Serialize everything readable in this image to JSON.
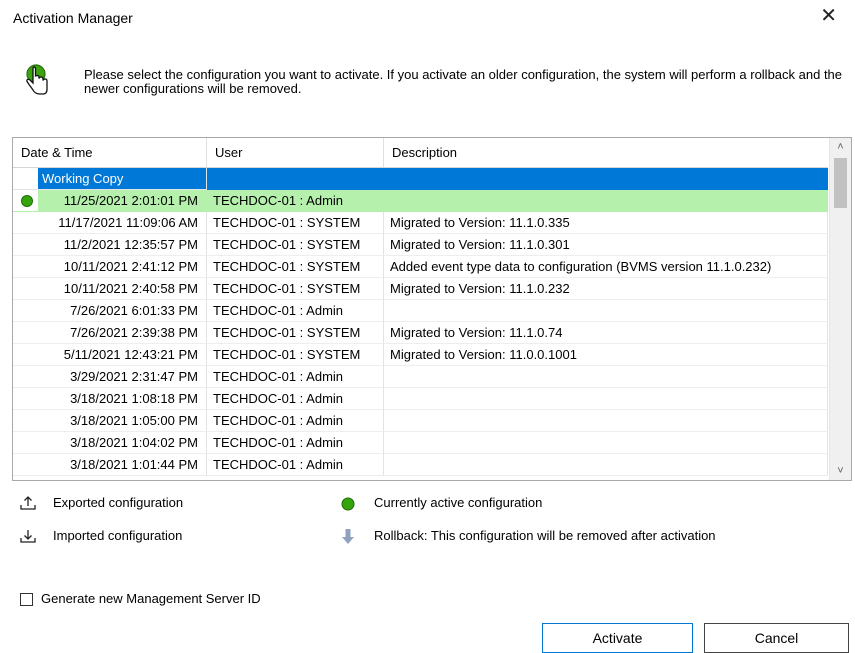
{
  "window": {
    "title": "Activation Manager",
    "close_glyph": "✕"
  },
  "instruction": "Please select the configuration you want to activate. If you activate an older configuration, the system will perform a rollback and the newer configurations will be removed.",
  "table": {
    "columns": [
      "Date & Time",
      "User",
      "Description"
    ],
    "rows": [
      {
        "datetime": "Working Copy",
        "user": "",
        "description": ""
      },
      {
        "datetime": "11/25/2021 2:01:01 PM",
        "user": "TECHDOC-01 : Admin",
        "description": ""
      },
      {
        "datetime": "11/17/2021 11:09:06 AM",
        "user": "TECHDOC-01 : SYSTEM",
        "description": "Migrated to Version: 11.1.0.335"
      },
      {
        "datetime": "11/2/2021 12:35:57 PM",
        "user": "TECHDOC-01 : SYSTEM",
        "description": "Migrated to Version: 11.1.0.301"
      },
      {
        "datetime": "10/11/2021 2:41:12 PM",
        "user": "TECHDOC-01 : SYSTEM",
        "description": "Added event type data to configuration (BVMS version 11.1.0.232)"
      },
      {
        "datetime": "10/11/2021 2:40:58 PM",
        "user": "TECHDOC-01 : SYSTEM",
        "description": "Migrated to Version: 11.1.0.232"
      },
      {
        "datetime": "7/26/2021 6:01:33 PM",
        "user": "TECHDOC-01 : Admin",
        "description": ""
      },
      {
        "datetime": "7/26/2021 2:39:38 PM",
        "user": "TECHDOC-01 : SYSTEM",
        "description": "Migrated to Version: 11.1.0.74"
      },
      {
        "datetime": "5/11/2021 12:43:21 PM",
        "user": "TECHDOC-01 : SYSTEM",
        "description": "Migrated to Version: 11.0.0.1001"
      },
      {
        "datetime": "3/29/2021 2:31:47 PM",
        "user": "TECHDOC-01 : Admin",
        "description": ""
      },
      {
        "datetime": "3/18/2021 1:08:18 PM",
        "user": "TECHDOC-01 : Admin",
        "description": ""
      },
      {
        "datetime": "3/18/2021 1:05:00 PM",
        "user": "TECHDOC-01 : Admin",
        "description": ""
      },
      {
        "datetime": "3/18/2021 1:04:02 PM",
        "user": "TECHDOC-01 : Admin",
        "description": ""
      },
      {
        "datetime": "3/18/2021 1:01:44 PM",
        "user": "TECHDOC-01 : Admin",
        "description": ""
      }
    ],
    "selected_row_color": "#0078d7",
    "active_row_color": "#b5f0ac"
  },
  "legend": {
    "exported": "Exported configuration",
    "imported": "Imported configuration",
    "active": "Currently active configuration",
    "rollback": "Rollback: This configuration will be removed after activation"
  },
  "checkbox": {
    "label": "Generate new Management Server ID",
    "checked": false
  },
  "buttons": {
    "activate": "Activate",
    "cancel": "Cancel"
  }
}
